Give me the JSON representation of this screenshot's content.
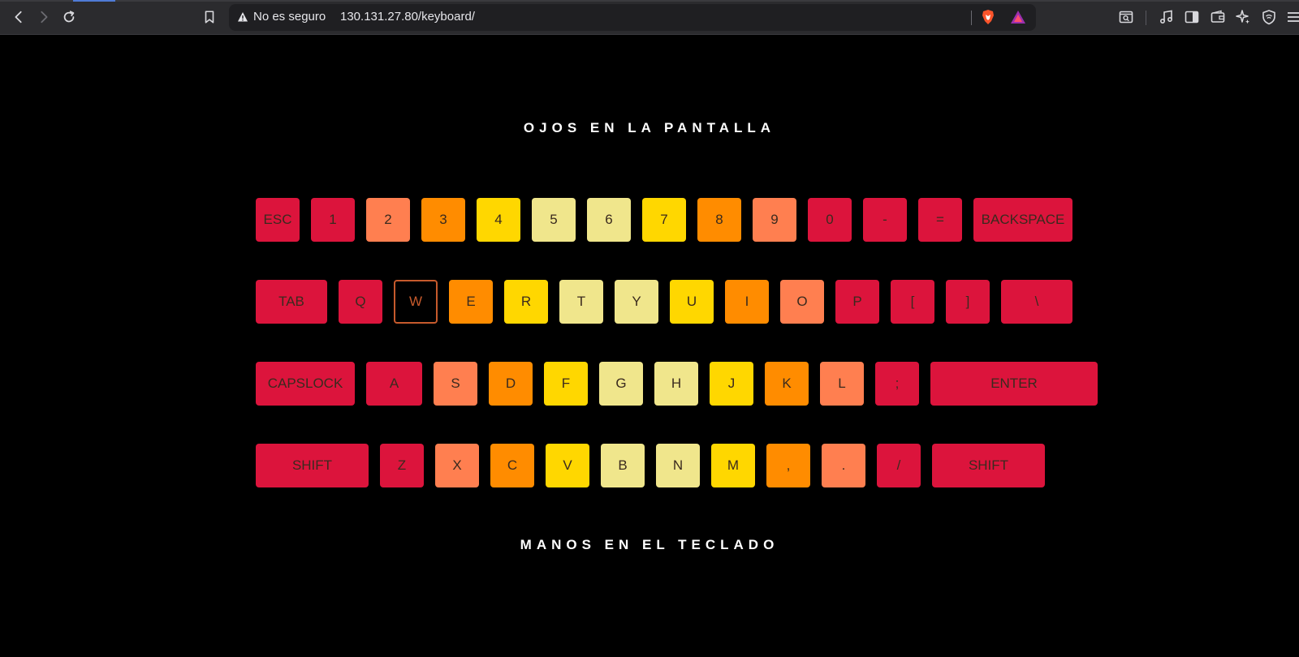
{
  "browser": {
    "address_warning": "No es seguro",
    "url": "130.131.27.80/keyboard/"
  },
  "page": {
    "heading_top": "OJOS EN LA PANTALLA",
    "heading_bottom": "MANOS EN EL TECLADO"
  },
  "colors": {
    "crimson": "#dc143c",
    "coral": "#ff7f50",
    "orange": "#ff8c00",
    "gold": "#ffd700",
    "khaki": "#f0e68c",
    "page_bg": "#000000"
  },
  "keyboard": {
    "rows": [
      {
        "keys": [
          {
            "label": "ESC",
            "color": "crimson"
          },
          {
            "label": "1",
            "color": "crimson"
          },
          {
            "label": "2",
            "color": "coral"
          },
          {
            "label": "3",
            "color": "orange"
          },
          {
            "label": "4",
            "color": "gold"
          },
          {
            "label": "5",
            "color": "khaki"
          },
          {
            "label": "6",
            "color": "khaki"
          },
          {
            "label": "7",
            "color": "gold"
          },
          {
            "label": "8",
            "color": "orange"
          },
          {
            "label": "9",
            "color": "coral"
          },
          {
            "label": "0",
            "color": "crimson"
          },
          {
            "label": "-",
            "color": "crimson"
          },
          {
            "label": "=",
            "color": "crimson"
          },
          {
            "label": "BACKSPACE",
            "color": "crimson"
          }
        ]
      },
      {
        "keys": [
          {
            "label": "TAB",
            "color": "crimson"
          },
          {
            "label": "Q",
            "color": "crimson"
          },
          {
            "label": "W",
            "color": "coral",
            "active": true
          },
          {
            "label": "E",
            "color": "orange"
          },
          {
            "label": "R",
            "color": "gold"
          },
          {
            "label": "T",
            "color": "khaki"
          },
          {
            "label": "Y",
            "color": "khaki"
          },
          {
            "label": "U",
            "color": "gold"
          },
          {
            "label": "I",
            "color": "orange"
          },
          {
            "label": "O",
            "color": "coral"
          },
          {
            "label": "P",
            "color": "crimson"
          },
          {
            "label": "[",
            "color": "crimson"
          },
          {
            "label": "]",
            "color": "crimson"
          },
          {
            "label": "\\",
            "color": "crimson"
          }
        ]
      },
      {
        "keys": [
          {
            "label": "CAPSLOCK",
            "color": "crimson"
          },
          {
            "label": "A",
            "color": "crimson"
          },
          {
            "label": "S",
            "color": "coral"
          },
          {
            "label": "D",
            "color": "orange"
          },
          {
            "label": "F",
            "color": "gold"
          },
          {
            "label": "G",
            "color": "khaki"
          },
          {
            "label": "H",
            "color": "khaki"
          },
          {
            "label": "J",
            "color": "gold"
          },
          {
            "label": "K",
            "color": "orange"
          },
          {
            "label": "L",
            "color": "coral"
          },
          {
            "label": ";",
            "color": "crimson"
          },
          {
            "label": "ENTER",
            "color": "crimson"
          }
        ]
      },
      {
        "keys": [
          {
            "label": "SHIFT",
            "color": "crimson"
          },
          {
            "label": "Z",
            "color": "crimson"
          },
          {
            "label": "X",
            "color": "coral"
          },
          {
            "label": "C",
            "color": "orange"
          },
          {
            "label": "V",
            "color": "gold"
          },
          {
            "label": "B",
            "color": "khaki"
          },
          {
            "label": "N",
            "color": "khaki"
          },
          {
            "label": "M",
            "color": "gold"
          },
          {
            "label": ",",
            "color": "orange"
          },
          {
            "label": ".",
            "color": "coral"
          },
          {
            "label": "/",
            "color": "crimson"
          },
          {
            "label": "SHIFT",
            "color": "crimson"
          }
        ]
      }
    ]
  }
}
